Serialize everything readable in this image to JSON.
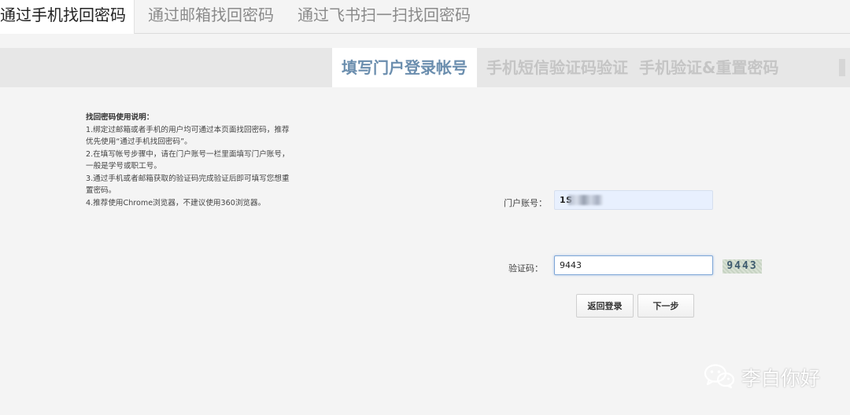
{
  "tabs": [
    {
      "label": "通过手机找回密码",
      "active": true
    },
    {
      "label": "通过邮箱找回密码",
      "active": false
    },
    {
      "label": "通过飞书扫一扫找回密码",
      "active": false
    }
  ],
  "steps": [
    {
      "label": "填写门户登录帐号",
      "active": true
    },
    {
      "label": "手机短信验证码验证",
      "active": false
    },
    {
      "label": "手机验证&重置密码",
      "active": false
    }
  ],
  "instructions": {
    "title": "找回密码使用说明：",
    "items": [
      "1.绑定过邮箱或者手机的用户均可通过本页面找回密码，推荐优先使用“通过手机找回密码”。",
      "2.在填写帐号步骤中，请在门户账号一栏里面填写门户账号，一般是学号或职工号。",
      "3.通过手机或者邮箱获取的验证码完成验证后即可填写您想重置密码。",
      "4.推荐使用Chrome浏览器，不建议使用360浏览器。"
    ]
  },
  "form": {
    "account_label": "门户账号：",
    "account_value": "1S",
    "captcha_label": "验证码：",
    "captcha_value": "9443",
    "captcha_image_text": "9443"
  },
  "buttons": {
    "back": "返回登录",
    "next": "下一步"
  },
  "watermark": {
    "text": "李白你好",
    "icon": "wechat-icon"
  },
  "colors": {
    "active_step": "#6b8eae",
    "inactive_step": "#c5c5c5",
    "account_fill": "#e8f0fe",
    "focus_border": "#7ea6d6"
  }
}
